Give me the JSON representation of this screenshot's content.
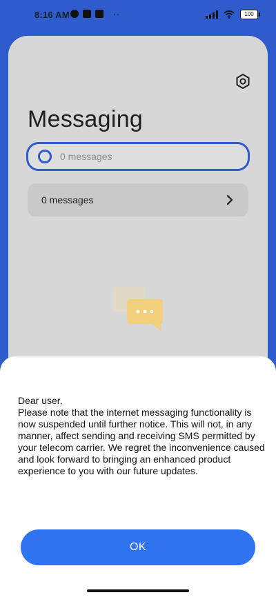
{
  "status_bar": {
    "time": "8:16 AM",
    "battery": "100",
    "overflow": "··"
  },
  "header": {
    "title": "Messaging",
    "settings_icon": "gear-icon"
  },
  "search": {
    "placeholder": "0 messages"
  },
  "list": {
    "row_label": "0 messages"
  },
  "dialog": {
    "greeting": "Dear user,",
    "body": "Please note that the internet messaging functionality is now suspended until further notice. This will not, in any manner, affect sending and receiving SMS permitted by your telecom carrier. We regret the inconvenience caused and look forward to bringing an enhanced product experience to you with our future updates.",
    "ok_label": "OK"
  },
  "colors": {
    "accent": "#2f5ccc",
    "button": "#2f73f0",
    "illustration": "#f2cf7b"
  }
}
